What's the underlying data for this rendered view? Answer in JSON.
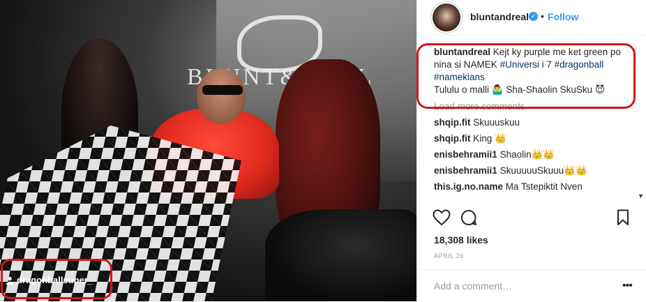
{
  "photo": {
    "brand_text": "BLUNT&REAL",
    "tagged_user": "dragonballsuper_"
  },
  "header": {
    "username": "bluntandreal",
    "separator": "•",
    "follow_label": "Follow"
  },
  "caption": {
    "user": "bluntandreal",
    "text": "Kejt ky purple me ket green po nina si NAMEK",
    "tags": [
      "#Universi",
      "#dragonball",
      "#namekians"
    ],
    "mid_text": "i 7",
    "line2": "Tululu o malli 🤷‍♂️ Sha-Shaolin SkuSku 😈"
  },
  "load_more": "Load more comments",
  "comments": [
    {
      "user": "shqip.fit",
      "text": "Skuuuskuu"
    },
    {
      "user": "shqip.fit",
      "text": "King 👑"
    },
    {
      "user": "enisbehramii1",
      "text": "Shaolin👑👑"
    },
    {
      "user": "enisbehramii1",
      "text": "SkuuuuuSkuuu👑👑"
    },
    {
      "user": "this.ig.no.name",
      "text": "Ma Tstepiktit Nven"
    }
  ],
  "likes": "18,308 likes",
  "date": "APRIL 26",
  "add_comment_placeholder": "Add a comment…",
  "more_label": "•••",
  "colors": {
    "accent": "#3897f0",
    "highlight_red": "#d4151b",
    "hashtag": "#003569"
  }
}
